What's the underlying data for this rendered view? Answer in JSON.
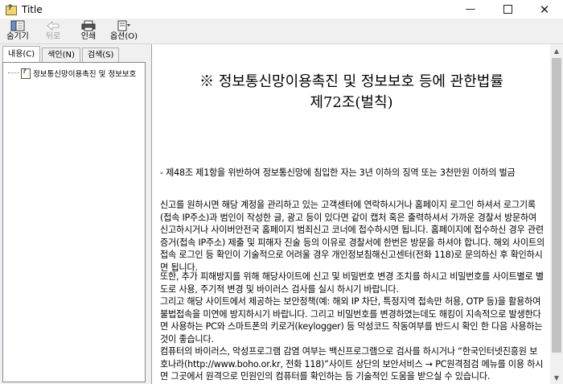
{
  "window": {
    "title": "Title"
  },
  "toolbar": {
    "buttons": [
      {
        "label": "숨기기",
        "icon": "hide-pane-icon",
        "enabled": true
      },
      {
        "label": "뒤로",
        "icon": "back-arrow-icon",
        "enabled": false
      },
      {
        "label": "인쇄",
        "icon": "printer-icon",
        "enabled": true
      },
      {
        "label": "옵션(O)",
        "icon": "options-icon",
        "enabled": true
      }
    ]
  },
  "sidebar": {
    "tabs": [
      {
        "label": "내용(C)",
        "active": true
      },
      {
        "label": "색인(N)",
        "active": false
      },
      {
        "label": "검색(S)",
        "active": false
      }
    ],
    "tree": [
      {
        "label": "정보통신망이용촉진 및 정보보호",
        "icon": "help-topic-icon"
      }
    ]
  },
  "content": {
    "title_line1": "※ 정보통신망이용촉진 및 정보보호 등에 관한법률",
    "title_line2": "제72조(벌칙)",
    "paragraphs": [
      "- 제48조 제1항을 위반하여 정보통신망에 침입한 자는 3년 이하의 징역 또는 3천만원 이하의 벌금",
      "신고를 원하시면 해당 계정을 관리하고 있는 고객센터에 연락하시거나 홈페이지 로그인 하셔서 로그기록(접속 IP주소)과 범인이 작성한 글, 광고 등이 있다면 같이 캡처 혹은 출력하셔서 가까운 경찰서 방문하여 신고하시거나 사이버안전국 홈페이지 범죄신고 코너에 접수하시면 됩니다. 홈페이지에 접수하신 경우 관련증거(접속 IP주소) 제출 및 피해자 진술 등의 이유로 경찰서에 한번은 방문을 하셔야 합니다. 해외 사이트의 접속 로그인 등 확인이 기술적으로 어려울 경우 개인정보침해신고센터(전화 118)로 문의하신 후 확인하시면 됩니다.",
      "또한, 추가 피해방지를 위해 해당사이트에 신고 및 비밀번호 변경 조치를 하시고 비밀번호를 사이트별로 별도로 사용, 주기적 변경 및 바이러스 검사를 실시 하시기 바랍니다.\n그리고 해당 사이트에서 제공하는 보안정책(예: 해외 IP 차단, 특정지역 접속만 허용, OTP 등)을 활용하여 불법접속을 미연에 방지하시기 바랍니다. 그리고 비밀번호를 변경하였는데도 해킹이 지속적으로 발생한다면 사용하는 PC와 스마트폰의 키로거(keylogger) 등 악성코드 작동여부를 반드시 확인 한 다음 사용하는 것이 좋습니다.\n컴퓨터의 바이러스, 악성프로그램 감염 여부는 백신프로그램으로 검사를 하시거나 “한국인터넷진흥원 보호나라(http://www.boho.or.kr, 전화 118)”사이트 상단의 보안서비스 → PC원격점검 메뉴를 이용 하시면 그곳에서 원격으로 민원인의 컴퓨터를 확인하는 등 기술적인 도움을 받으실 수 있습니다."
    ]
  }
}
